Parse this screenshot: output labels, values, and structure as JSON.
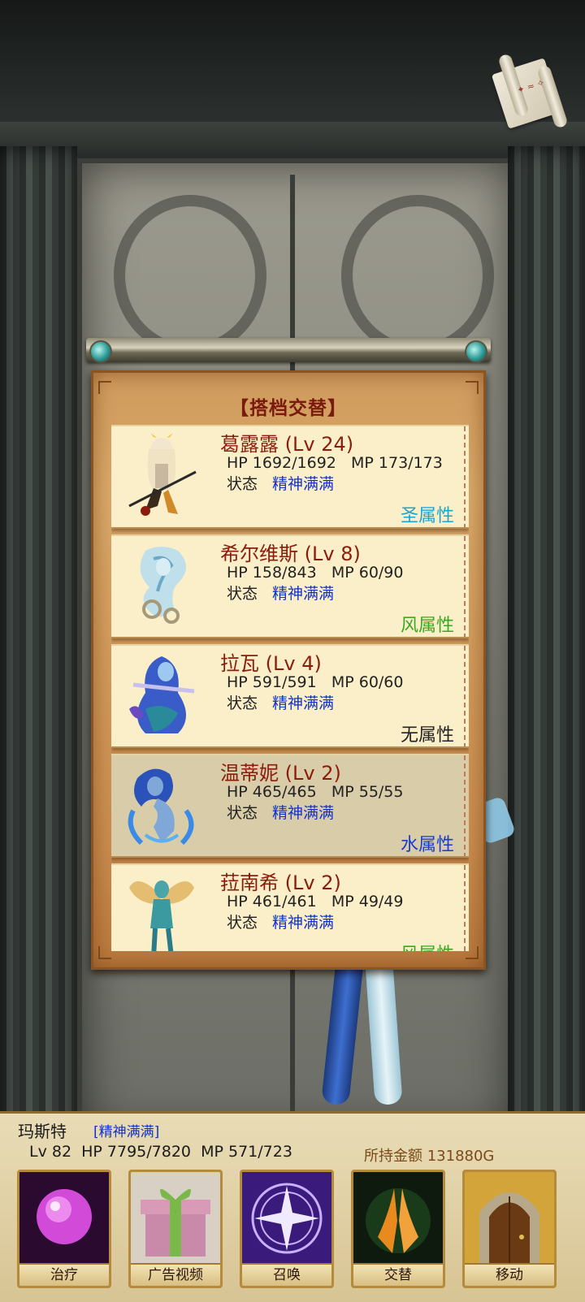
{
  "dialog": {
    "title": "【搭档交替】",
    "state_label": "状态",
    "partners": [
      {
        "name": "葛露露  (Lv 24)",
        "stats": "HP 1692/1692   MP 173/173",
        "state": "精神满满",
        "attribute": "圣属性",
        "attribute_color": "#18a6d8"
      },
      {
        "name": "希尔维斯  (Lv 8)",
        "stats": "HP 158/843   MP 60/90",
        "state": "精神满满",
        "attribute": "风属性",
        "attribute_color": "#3aa81f"
      },
      {
        "name": "拉瓦  (Lv 4)",
        "stats": "HP 591/591   MP 60/60",
        "state": "精神满满",
        "attribute": "无属性",
        "attribute_color": "#222222"
      },
      {
        "name": "温蒂妮  (Lv 2)",
        "stats": "HP 465/465   MP 55/55",
        "state": "精神满满",
        "attribute": "水属性",
        "attribute_color": "#1a3ad0"
      },
      {
        "name": "菈南希  (Lv 2)",
        "stats": "HP 461/461   MP 49/49",
        "state": "精神满满",
        "attribute": "风属性",
        "attribute_color": "#3aa81f"
      }
    ]
  },
  "player": {
    "name": "玛斯特",
    "state": "[精神满满]",
    "stats": "Lv 82  HP 7795/7820  MP 571/723",
    "gold": "所持金额 131880G"
  },
  "buttons": [
    {
      "label": "治疗",
      "icon": "magic-orb-icon"
    },
    {
      "label": "广告视频",
      "icon": "gift-box-icon"
    },
    {
      "label": "召唤",
      "icon": "summon-circle-icon"
    },
    {
      "label": "交替",
      "icon": "praying-hands-icon"
    },
    {
      "label": "移动",
      "icon": "door-icon"
    }
  ]
}
